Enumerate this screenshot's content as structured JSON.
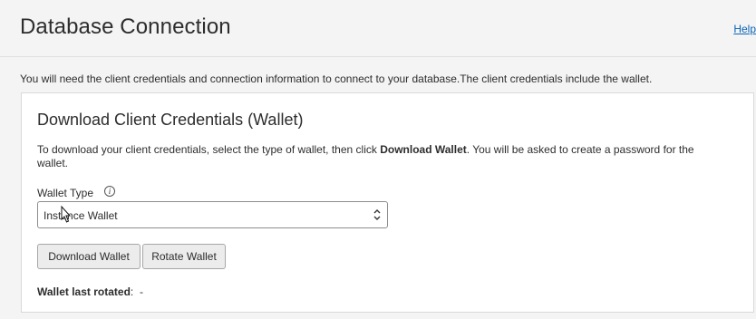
{
  "header": {
    "title": "Database Connection",
    "help_label": "Help"
  },
  "intro_text": "You will need the client credentials and connection information to connect to your database.The client credentials include the wallet.",
  "card": {
    "title": "Download Client Credentials (Wallet)",
    "desc_prefix": "To download your client credentials, select the type of wallet, then click ",
    "desc_bold": "Download Wallet",
    "desc_suffix": ". You will be asked to create a password for the wallet.",
    "wallet_type_label": "Wallet Type",
    "info_icon_glyph": "i",
    "wallet_type_value": "Instance Wallet",
    "download_button_label": "Download Wallet",
    "rotate_button_label": "Rotate Wallet",
    "last_rotated_label": "Wallet last rotated",
    "last_rotated_sep": ":",
    "last_rotated_value": "-"
  },
  "colors": {
    "link": "#0a63b8",
    "page_bg": "#f4f4f4",
    "card_bg": "#ffffff"
  },
  "icons": {
    "info": "info-circle-icon",
    "select_chevron": "up-down-chevron-icon",
    "cursor": "text-cursor-icon"
  }
}
